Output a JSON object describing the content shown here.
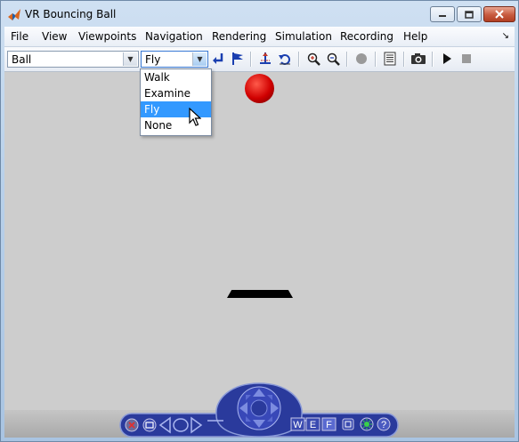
{
  "window": {
    "title": "VR Bouncing Ball"
  },
  "menu": [
    "File",
    "View",
    "Viewpoints",
    "Navigation",
    "Rendering",
    "Simulation",
    "Recording",
    "Help"
  ],
  "toolbar": {
    "viewpoint_value": "Ball",
    "navigation_value": "Fly",
    "icons": [
      "return-to-viewpoint-icon",
      "new-viewpoint-icon",
      "straighten-up-icon",
      "undo-move-icon",
      "zoom-in-icon",
      "zoom-out-icon",
      "record-icon",
      "capture-frame-icon",
      "snapshot-camera-icon",
      "play-icon",
      "stop-icon"
    ]
  },
  "navigation_dropdown": {
    "options": [
      "Walk",
      "Examine",
      "Fly",
      "None"
    ],
    "selected": "Fly"
  },
  "nav_panel": {
    "buttons": [
      "W",
      "E",
      "F"
    ]
  },
  "colors": {
    "ball": "#d00000",
    "viewport": "#cdcdcd",
    "selection": "#3399ff",
    "nav_panel": "#2a3a9c"
  }
}
